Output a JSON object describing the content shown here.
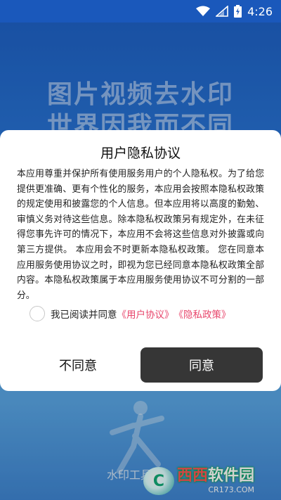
{
  "status_bar": {
    "time": "4:26",
    "icons": [
      "wifi-icon",
      "signal-icon",
      "battery-icon"
    ]
  },
  "splash": {
    "title_line1": "图片视频去水印",
    "title_line2": "世界因我而不同",
    "app_name": "水印工具",
    "brand_main_part1": "西西",
    "brand_main_part2": "软件园",
    "brand_sub": "CR173.COM",
    "brand_logo_letter": "C"
  },
  "dialog": {
    "title": "用户隐私协议",
    "body": "本应用尊重并保护所有使用服务用户的个人隐私权。为了给您提供更准确、更有个性化的服务，本应用会按照本隐私权政策的规定使用和披露您的个人信息。但本应用将以高度的勤勉、审慎义务对待这些信息。除本隐私权政策另有规定外，在未征得您事先许可的情况下，本应用不会将这些信息对外披露或向第三方提供。 本应用会不时更新本隐私权政策。 您在同意本应用服务使用协议之时，即视为您已经同意本隐私权政策全部内容。本隐私权政策属于本应用服务使用协议不可分割的一部分。",
    "agree_prefix": "我已阅读并同意",
    "user_agreement_link": "《用户协议》",
    "privacy_policy_link": "《隐私政策》",
    "disagree_label": "不同意",
    "agree_label": "同意"
  },
  "colors": {
    "link": "#e8456b",
    "agree_button_bg": "#363636",
    "background_blue": "#1e63c8"
  }
}
